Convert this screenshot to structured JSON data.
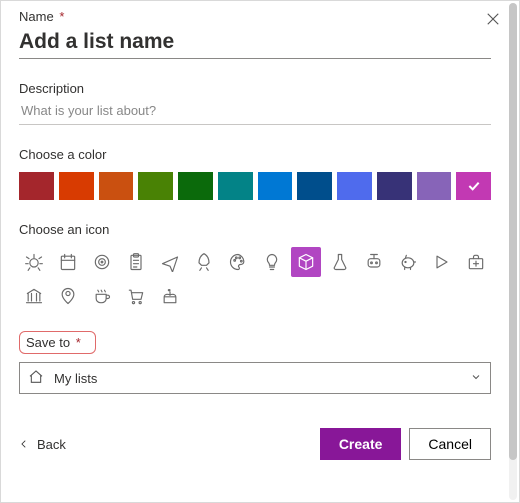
{
  "name": {
    "label": "Name",
    "required_mark": "*",
    "placeholder": "Add a list name",
    "value": ""
  },
  "description": {
    "label": "Description",
    "placeholder": "What is your list about?",
    "value": ""
  },
  "color_section": {
    "label": "Choose a color",
    "colors": [
      "#a4262c",
      "#d83b01",
      "#ca5010",
      "#498205",
      "#0b6a0b",
      "#038387",
      "#0078d4",
      "#004e8c",
      "#4f6bed",
      "#373277",
      "#8764b8",
      "#c239b3"
    ],
    "selected_index": 11
  },
  "icon_section": {
    "label": "Choose an icon",
    "icons": [
      "bug-icon",
      "calendar-icon",
      "target-icon",
      "clipboard-icon",
      "airplane-icon",
      "rocket-icon",
      "palette-icon",
      "lightbulb-icon",
      "cube-icon",
      "flask-icon",
      "bot-icon",
      "piggybank-icon",
      "run-icon",
      "firstaid-icon",
      "bank-icon",
      "location-icon",
      "coffee-icon",
      "cart-icon",
      "cake-icon"
    ],
    "selected_index": 8
  },
  "save_to": {
    "label": "Save to",
    "required_mark": "*",
    "selected": "My lists"
  },
  "footer": {
    "back": "Back",
    "create": "Create",
    "cancel": "Cancel"
  }
}
